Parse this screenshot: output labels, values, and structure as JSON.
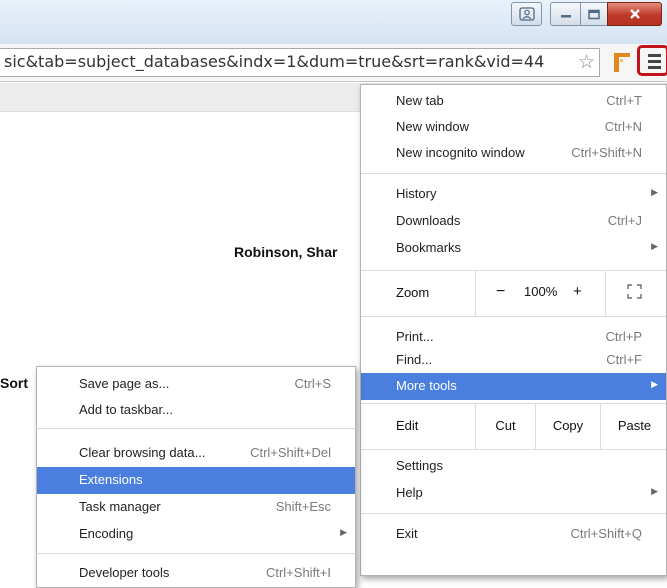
{
  "browser": {
    "url": "sic&tab=subject_databases&indx=1&dum=true&srt=rank&vid=44",
    "icons": [
      "user-icon",
      "minimize-icon",
      "maximize-icon",
      "close-icon",
      "bookmark-star-icon",
      "extension-icon",
      "chrome-menu-icon"
    ]
  },
  "page": {
    "author": "Robinson, Shar",
    "sort_label": "Sort"
  },
  "main_menu": {
    "new_tab": {
      "label": "New tab",
      "shortcut": "Ctrl+T"
    },
    "new_window": {
      "label": "New window",
      "shortcut": "Ctrl+N"
    },
    "new_incognito": {
      "label": "New incognito window",
      "shortcut": "Ctrl+Shift+N"
    },
    "history": {
      "label": "History"
    },
    "downloads": {
      "label": "Downloads",
      "shortcut": "Ctrl+J"
    },
    "bookmarks": {
      "label": "Bookmarks"
    },
    "zoom": {
      "label": "Zoom",
      "minus": "−",
      "value": "100%",
      "plus": "+"
    },
    "print": {
      "label": "Print...",
      "shortcut": "Ctrl+P"
    },
    "find": {
      "label": "Find...",
      "shortcut": "Ctrl+F"
    },
    "more_tools": {
      "label": "More tools"
    },
    "edit": {
      "label": "Edit",
      "cut": "Cut",
      "copy": "Copy",
      "paste": "Paste"
    },
    "settings": {
      "label": "Settings"
    },
    "help": {
      "label": "Help"
    },
    "exit": {
      "label": "Exit",
      "shortcut": "Ctrl+Shift+Q"
    }
  },
  "sub_menu": {
    "save_page": {
      "label": "Save page as...",
      "shortcut": "Ctrl+S"
    },
    "add_taskbar": {
      "label": "Add to taskbar..."
    },
    "clear_data": {
      "label": "Clear browsing data...",
      "shortcut": "Ctrl+Shift+Del"
    },
    "extensions": {
      "label": "Extensions"
    },
    "task_manager": {
      "label": "Task manager",
      "shortcut": "Shift+Esc"
    },
    "encoding": {
      "label": "Encoding"
    },
    "developer_tools": {
      "label": "Developer tools",
      "shortcut": "Ctrl+Shift+I"
    }
  },
  "colors": {
    "highlight": "#4a7fe0",
    "menu_button_outline": "#c0141a",
    "close_button": "#c0392b"
  }
}
